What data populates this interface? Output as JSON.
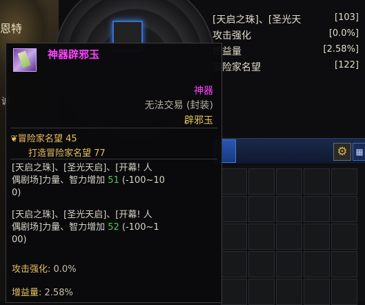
{
  "background": {
    "npc_name": "恩特",
    "side_text": "诚"
  },
  "stats_panel": {
    "rows": [
      {
        "label": "[天启之珠]、[圣光天",
        "value": "[103]"
      },
      {
        "label": "攻击强化",
        "value": "[0.0%]"
      },
      {
        "label": "增益量",
        "value": "[2.58%]"
      },
      {
        "label": "冒险家名望",
        "value": "[122]"
      }
    ]
  },
  "inventory": {
    "gear_icon": "gear-icon",
    "grid_icon": "grid-icon"
  },
  "tooltip": {
    "item_name": "神器辟邪玉",
    "rarity": "神器",
    "trade": "无法交易 (封装)",
    "sub_type": "辟邪玉",
    "fame_label": "冒险家名望",
    "fame_value": "45",
    "craft_fame_label": "打造冒险家名望",
    "craft_fame_value": "77",
    "options": [
      {
        "line1": "[天启之珠]、[圣光天启]、[开幕! 人",
        "line2_prefix": "偶剧场]力量、智力增加 ",
        "num": "51",
        "range": " (-100~10",
        "line3": "0)"
      },
      {
        "line1": "[天启之珠]、[圣光天启]、[开幕! 人",
        "line2_prefix": "偶剧场]力量、智力增加 ",
        "num": "52",
        "range": " (-100~1",
        "line3": "00)"
      }
    ],
    "attack_label": "攻击强化: ",
    "attack_value": "0.0%",
    "buff_label": "增益量: ",
    "buff_value": "2.58%"
  },
  "colors": {
    "epic": "#ff44ff",
    "gold": "#e8c060",
    "green": "#58c858"
  }
}
